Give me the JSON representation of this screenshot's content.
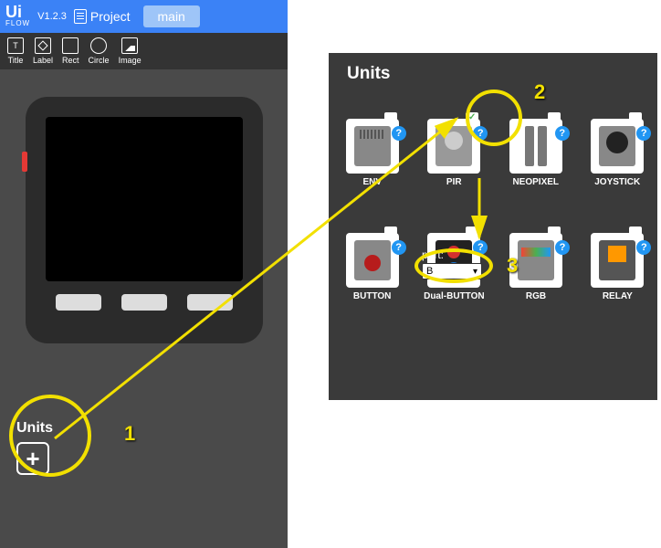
{
  "header": {
    "logo_top": "Ui",
    "logo_bottom": "FLOW",
    "version": "V1.2.3",
    "project_label": "Project",
    "tab_name": "main"
  },
  "tools": {
    "title": "Title",
    "label": "Label",
    "rect": "Rect",
    "circle": "Circle",
    "image": "Image"
  },
  "left_units": {
    "title": "Units"
  },
  "right_panel": {
    "title": "Units",
    "port_label": "port:",
    "port_value": "B",
    "units_row1": [
      {
        "name": "ENV"
      },
      {
        "name": "PIR"
      },
      {
        "name": "NEOPIXEL"
      },
      {
        "name": "JOYSTICK"
      }
    ],
    "units_row2": [
      {
        "name": "BUTTON"
      },
      {
        "name": "Dual-BUTTON"
      },
      {
        "name": "RGB"
      },
      {
        "name": "RELAY"
      }
    ]
  },
  "annotations": {
    "n1": "1",
    "n2": "2",
    "n3": "3"
  }
}
